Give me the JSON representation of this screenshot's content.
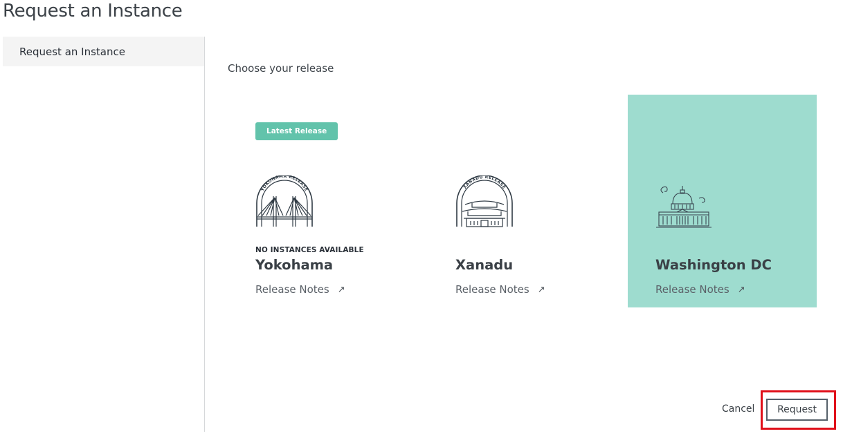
{
  "page": {
    "title": "Request an Instance"
  },
  "sidebar": {
    "items": [
      {
        "label": "Request an Instance",
        "active": true
      }
    ]
  },
  "main": {
    "section_label": "Choose your release",
    "releases": [
      {
        "name": "Yokohama",
        "badge": "Latest Release",
        "availability": "NO INSTANCES AVAILABLE",
        "logo_text": "YOKOHAMA RELEASE",
        "logo_icon": "bridge-icon",
        "notes_label": "Release Notes",
        "selected": false
      },
      {
        "name": "Xanadu",
        "logo_text": "XANADU RELEASE",
        "logo_icon": "palace-icon",
        "notes_label": "Release Notes",
        "selected": false
      },
      {
        "name": "Washington DC",
        "logo_icon": "capitol-icon",
        "notes_label": "Release Notes",
        "selected": true
      }
    ]
  },
  "actions": {
    "cancel_label": "Cancel",
    "request_label": "Request"
  },
  "colors": {
    "selected_card": "#9edccf",
    "badge": "#62c3ab",
    "highlight": "#e0101a",
    "sidebar_active": "#f4f4f4"
  }
}
